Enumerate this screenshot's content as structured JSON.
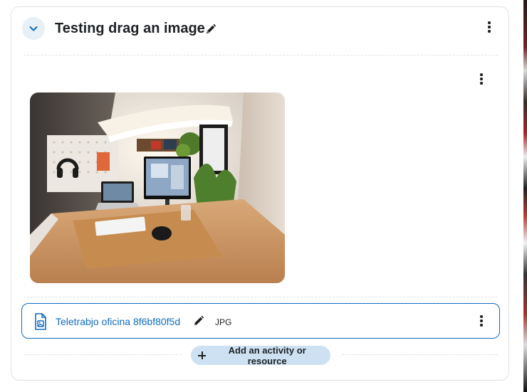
{
  "section": {
    "title": "Testing drag an image"
  },
  "resource": {
    "name": "Teletrabjo oficina 8f6bf80f5d",
    "type": "JPG"
  },
  "add_activity": {
    "label": "Add an activity or resource"
  },
  "icons": {
    "collapse": "chevron-down-icon",
    "edit": "pencil-icon",
    "menu": "kebab-menu-icon",
    "file": "image-file-icon",
    "add": "plus-icon"
  },
  "colors": {
    "accent": "#0f6cbf",
    "add_button_bg": "#cde1f2",
    "collapse_bg": "#e7f0f7",
    "border": "#dee2e6",
    "text": "#1d2125"
  }
}
